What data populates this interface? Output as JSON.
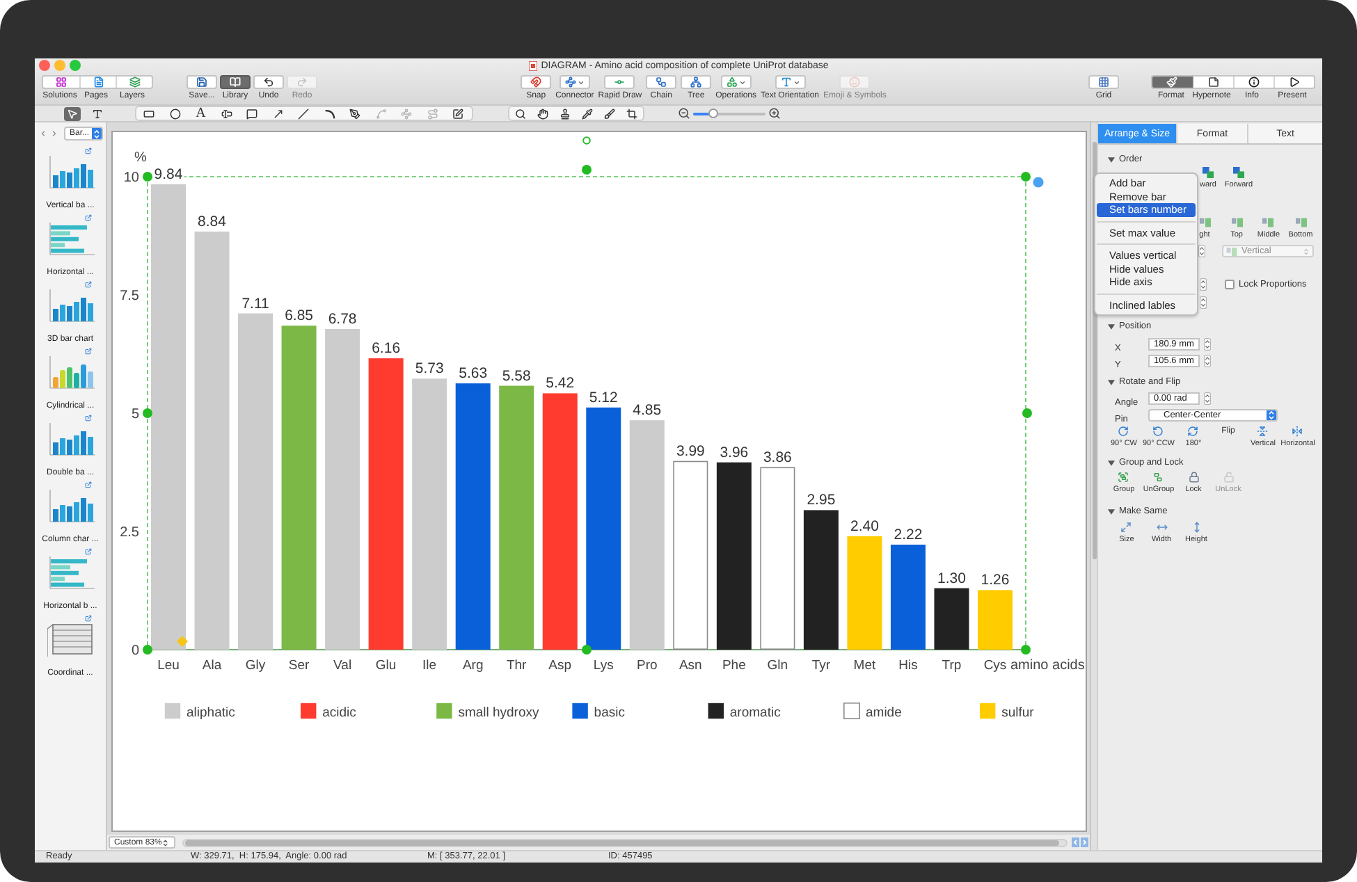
{
  "window": {
    "title": "DIAGRAM - Amino acid composition of complete UniProt database"
  },
  "toolbar": {
    "groups": [
      {
        "kind": "segmented",
        "buttons": [
          {
            "label": "Solutions",
            "selected": false,
            "disabled": false
          },
          {
            "label": "Pages",
            "selected": false,
            "disabled": false
          },
          {
            "label": "Layers",
            "selected": false,
            "disabled": false
          }
        ]
      },
      {
        "kind": "buttons",
        "buttons": [
          {
            "label": "Save...",
            "selected": false,
            "disabled": false
          },
          {
            "label": "Library",
            "selected": true,
            "disabled": false
          },
          {
            "label": "Undo",
            "selected": false,
            "disabled": false
          },
          {
            "label": "Redo",
            "selected": false,
            "disabled": true
          }
        ]
      },
      {
        "kind": "buttons",
        "buttons": [
          {
            "label": "Snap",
            "selected": false,
            "disabled": false,
            "dropdown": false
          },
          {
            "label": "Connector",
            "selected": false,
            "disabled": false,
            "dropdown": true
          },
          {
            "label": "Rapid Draw",
            "selected": false,
            "disabled": false,
            "dropdown": false
          },
          {
            "label": "Chain",
            "selected": false,
            "disabled": false,
            "dropdown": false
          },
          {
            "label": "Tree",
            "selected": false,
            "disabled": false,
            "dropdown": false
          },
          {
            "label": "Operations",
            "selected": false,
            "disabled": false,
            "dropdown": true
          },
          {
            "label": "Text Orientation",
            "selected": false,
            "disabled": false,
            "dropdown": true
          },
          {
            "label": "Emoji & Symbols",
            "selected": false,
            "disabled": true,
            "dropdown": false
          }
        ]
      },
      {
        "kind": "buttons",
        "buttons": [
          {
            "label": "Grid",
            "selected": false,
            "disabled": false
          }
        ]
      },
      {
        "kind": "segmented",
        "buttons": [
          {
            "label": "Format",
            "selected": true,
            "disabled": false
          },
          {
            "label": "Hypernote",
            "selected": false,
            "disabled": false
          },
          {
            "label": "Info",
            "selected": false,
            "disabled": false
          },
          {
            "label": "Present",
            "selected": false,
            "disabled": false
          }
        ]
      }
    ]
  },
  "drawing_tools": {
    "groups": [
      {
        "tools": [
          {
            "selected": true,
            "disabled": false
          },
          {
            "selected": false,
            "disabled": false
          }
        ]
      },
      {
        "tools": [
          {
            "selected": false,
            "disabled": false
          },
          {
            "selected": false,
            "disabled": false
          },
          {
            "glyph": "A",
            "selected": false,
            "disabled": false
          },
          {
            "selected": false,
            "disabled": false
          },
          {
            "selected": false,
            "disabled": false
          },
          {
            "selected": false,
            "disabled": false
          },
          {
            "selected": false,
            "disabled": false
          },
          {
            "selected": false,
            "disabled": false
          },
          {
            "selected": false,
            "disabled": false
          },
          {
            "selected": false,
            "disabled": true
          },
          {
            "selected": false,
            "disabled": true
          },
          {
            "selected": false,
            "disabled": true
          },
          {
            "selected": false,
            "disabled": false
          }
        ]
      },
      {
        "tools": [
          {
            "selected": false,
            "disabled": false
          },
          {
            "selected": false,
            "disabled": false
          },
          {
            "selected": false,
            "disabled": false
          },
          {
            "selected": false,
            "disabled": false
          },
          {
            "selected": false,
            "disabled": false
          },
          {
            "selected": false,
            "disabled": false
          }
        ]
      }
    ],
    "zoom_slider": {
      "level": 0.28
    }
  },
  "library": {
    "selector": "Bar...",
    "items": [
      {
        "label": "Vertical ba ...",
        "kind": "vertical"
      },
      {
        "label": "Horizontal ...",
        "kind": "horizontal"
      },
      {
        "label": "3D bar chart",
        "kind": "vertical"
      },
      {
        "label": "Cylindrical ...",
        "kind": "multicolor"
      },
      {
        "label": "Double ba ...",
        "kind": "vertical"
      },
      {
        "label": "Column char ...",
        "kind": "vertical"
      },
      {
        "label": "Horizontal b ...",
        "kind": "horizontal"
      },
      {
        "label": "Coordinat ...",
        "kind": "grid"
      }
    ]
  },
  "canvas": {
    "chart": {
      "selected": true,
      "chart_data": {
        "type": "bar",
        "xlabel": "amino acids",
        "ylabel": "%",
        "categories": [
          "Leu",
          "Ala",
          "Gly",
          "Ser",
          "Val",
          "Glu",
          "Ile",
          "Arg",
          "Thr",
          "Asp",
          "Lys",
          "Pro",
          "Asn",
          "Phe",
          "Gln",
          "Tyr",
          "Met",
          "His",
          "Trp",
          "Cys"
        ],
        "series": [
          {
            "name": "aliphatic",
            "color": "#cccccc",
            "values": [
              9.84,
              8.84,
              7.11,
              null,
              6.78,
              null,
              5.73,
              null,
              null,
              null,
              null,
              4.85,
              null,
              null,
              null,
              null,
              null,
              null,
              null,
              null
            ]
          },
          {
            "name": "acidic",
            "color": "#ff3b2f",
            "values": [
              null,
              null,
              null,
              null,
              null,
              6.16,
              null,
              null,
              null,
              5.42,
              null,
              null,
              null,
              null,
              null,
              null,
              null,
              null,
              null,
              null
            ]
          },
          {
            "name": "small hydroxy",
            "color": "#7cb846",
            "values": [
              null,
              null,
              null,
              6.85,
              null,
              null,
              null,
              null,
              5.58,
              null,
              null,
              null,
              null,
              null,
              null,
              null,
              null,
              null,
              null,
              null
            ]
          },
          {
            "name": "basic",
            "color": "#0a60d8",
            "values": [
              null,
              null,
              null,
              null,
              null,
              null,
              null,
              5.63,
              null,
              null,
              5.12,
              null,
              null,
              null,
              null,
              null,
              null,
              2.22,
              null,
              null
            ]
          },
          {
            "name": "aromatic",
            "color": "#222222",
            "values": [
              null,
              null,
              null,
              null,
              null,
              null,
              null,
              null,
              null,
              null,
              null,
              null,
              null,
              3.96,
              null,
              2.95,
              null,
              null,
              1.3,
              null
            ]
          },
          {
            "name": "amide",
            "color": "#ffffff",
            "values": [
              null,
              null,
              null,
              null,
              null,
              null,
              null,
              null,
              null,
              null,
              null,
              null,
              3.99,
              null,
              3.86,
              null,
              null,
              null,
              null,
              null
            ]
          },
          {
            "name": "sulfur",
            "color": "#ffcc00",
            "values": [
              null,
              null,
              null,
              null,
              null,
              null,
              null,
              null,
              null,
              null,
              null,
              null,
              null,
              null,
              null,
              null,
              2.4,
              null,
              null,
              1.26
            ]
          }
        ],
        "stacked": true,
        "ylim": [
          0,
          10
        ],
        "yticks": [
          0,
          2.5,
          5,
          7.5,
          10
        ],
        "value_labels": [
          "9.84",
          "8.84",
          "7.11",
          "6.85",
          "6.78",
          "6.16",
          "5.73",
          "5.63",
          "5.58",
          "5.42",
          "5.12",
          "4.85",
          "3.99",
          "3.96",
          "3.86",
          "2.95",
          "2.40",
          "2.22",
          "1.30",
          "1.26"
        ],
        "legend": true
      }
    },
    "zoom": "Custom 83%"
  },
  "context_menu": {
    "groups": [
      {
        "items": [
          {
            "label": "Add bar",
            "selected": false
          },
          {
            "label": "Remove bar",
            "selected": false
          },
          {
            "label": "Set bars number",
            "selected": true
          }
        ]
      },
      {
        "items": [
          {
            "label": "Set max value",
            "selected": false
          }
        ]
      },
      {
        "items": [
          {
            "label": "Values vertical",
            "selected": false
          },
          {
            "label": "Hide values",
            "selected": false
          },
          {
            "label": "Hide axis",
            "selected": false
          }
        ]
      },
      {
        "items": [
          {
            "label": "Inclined lables",
            "selected": false
          }
        ]
      }
    ]
  },
  "inspector": {
    "tabs": [
      {
        "label": "Arrange & Size",
        "selected": true
      },
      {
        "label": "Format",
        "selected": false
      },
      {
        "label": "Text",
        "selected": false
      }
    ],
    "order": {
      "title": "Order",
      "expanded": true,
      "buttons": [
        {
          "label": "ward"
        },
        {
          "label": "Forward"
        }
      ]
    },
    "align": {
      "buttons": [
        {
          "label": "ght"
        },
        {
          "label": "Top"
        },
        {
          "label": "Middle"
        },
        {
          "label": "Bottom"
        }
      ],
      "distribute": {
        "value": "Vertical",
        "disabled": true
      }
    },
    "size": {
      "lock_proportions": {
        "label": "Lock Proportions",
        "checked": false
      }
    },
    "position": {
      "title": "Position",
      "expanded": true,
      "fields": [
        {
          "label": "X",
          "value": "180.9 mm"
        },
        {
          "label": "Y",
          "value": "105.6 mm"
        }
      ]
    },
    "rotate_flip": {
      "title": "Rotate and Flip",
      "expanded": true,
      "angle": {
        "label": "Angle",
        "value": "0.00 rad"
      },
      "pin": {
        "label": "Pin",
        "value": "Center-Center"
      },
      "rotate_buttons": [
        {
          "label": "90° CW"
        },
        {
          "label": "90° CCW"
        },
        {
          "label": "180°"
        }
      ],
      "flip_label": "Flip",
      "flip_buttons": [
        {
          "label": "Vertical"
        },
        {
          "label": "Horizontal"
        }
      ]
    },
    "group_lock": {
      "title": "Group and Lock",
      "expanded": true,
      "buttons": [
        {
          "label": "Group",
          "disabled": false
        },
        {
          "label": "UnGroup",
          "disabled": false
        },
        {
          "label": "Lock",
          "disabled": false
        },
        {
          "label": "UnLock",
          "disabled": true
        }
      ]
    },
    "make_same": {
      "title": "Make Same",
      "expanded": true,
      "buttons": [
        {
          "label": "Size"
        },
        {
          "label": "Width"
        },
        {
          "label": "Height"
        }
      ]
    }
  },
  "status_bar": {
    "status": "Ready",
    "dimensions": "W: 329.71,  H: 175.94,  Angle: 0.00 rad",
    "mouse": "M: [ 353.77, 22.01 ]",
    "id": "ID: 457495"
  }
}
